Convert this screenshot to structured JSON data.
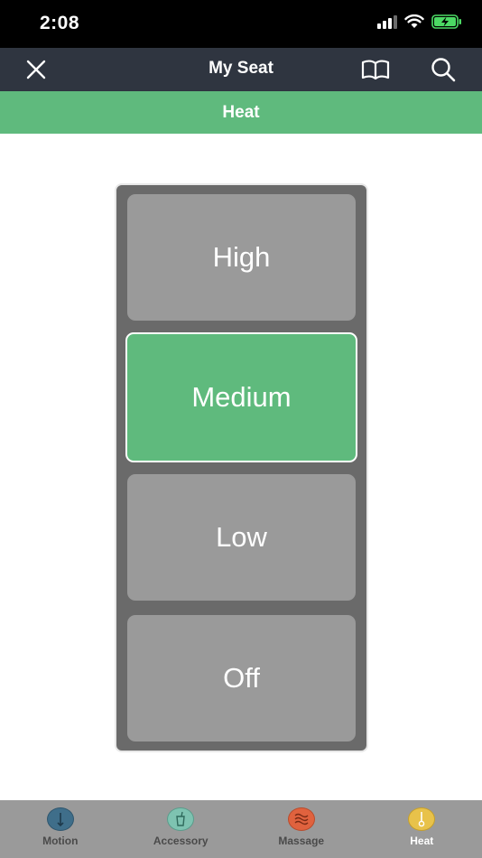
{
  "status_bar": {
    "time": "2:08"
  },
  "header": {
    "title": "My Seat"
  },
  "section": {
    "title": "Heat"
  },
  "heat_levels": [
    {
      "label": "High",
      "selected": false
    },
    {
      "label": "Medium",
      "selected": true
    },
    {
      "label": "Low",
      "selected": false
    },
    {
      "label": "Off",
      "selected": false
    }
  ],
  "tabs": [
    {
      "label": "Motion",
      "icon": "motion-icon",
      "color": "#3f6e8a"
    },
    {
      "label": "Accessory",
      "icon": "accessory-icon",
      "color": "#7ec3b1"
    },
    {
      "label": "Massage",
      "icon": "massage-icon",
      "color": "#e0623e"
    },
    {
      "label": "Heat",
      "icon": "heat-icon",
      "color": "#e8c24a",
      "active": true
    }
  ],
  "colors": {
    "accent_green": "#5fba7d",
    "nav_background": "#2f3540",
    "panel_background": "#6a6a6a",
    "button_gray": "#9a9a9a"
  }
}
